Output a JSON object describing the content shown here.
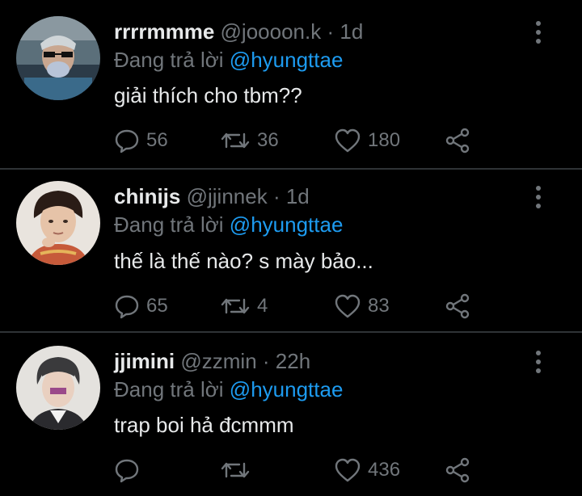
{
  "tweets": [
    {
      "display_name": "rrrrmmme",
      "handle": "@joooon.k",
      "time": "1d",
      "reply_prefix": "Đang trả lời",
      "reply_to": "@hyungttae",
      "text": "giải thích cho tbm??",
      "replies": "56",
      "retweets": "36",
      "likes": "180"
    },
    {
      "display_name": "chinijs",
      "handle": "@jjinnek",
      "time": "1d",
      "reply_prefix": "Đang trả lời",
      "reply_to": "@hyungttae",
      "text": "thế là thế nào? s mày bảo...",
      "replies": "65",
      "retweets": "4",
      "likes": "83"
    },
    {
      "display_name": "jjimini",
      "handle": "@zzmin",
      "time": "22h",
      "reply_prefix": "Đang trả lời",
      "reply_to": "@hyungttae",
      "text": "trap boi hả đcmmm",
      "replies": "",
      "retweets": "",
      "likes": "436"
    }
  ],
  "separator": "·",
  "colors": {
    "background": "#000000",
    "text": "#e7e9ea",
    "muted": "#71767b",
    "link": "#1d9bf0",
    "divider": "#2f3336"
  },
  "icons": {
    "reply": "reply-icon",
    "retweet": "retweet-icon",
    "like": "heart-icon",
    "share": "share-icon",
    "more": "more-vertical-icon"
  }
}
